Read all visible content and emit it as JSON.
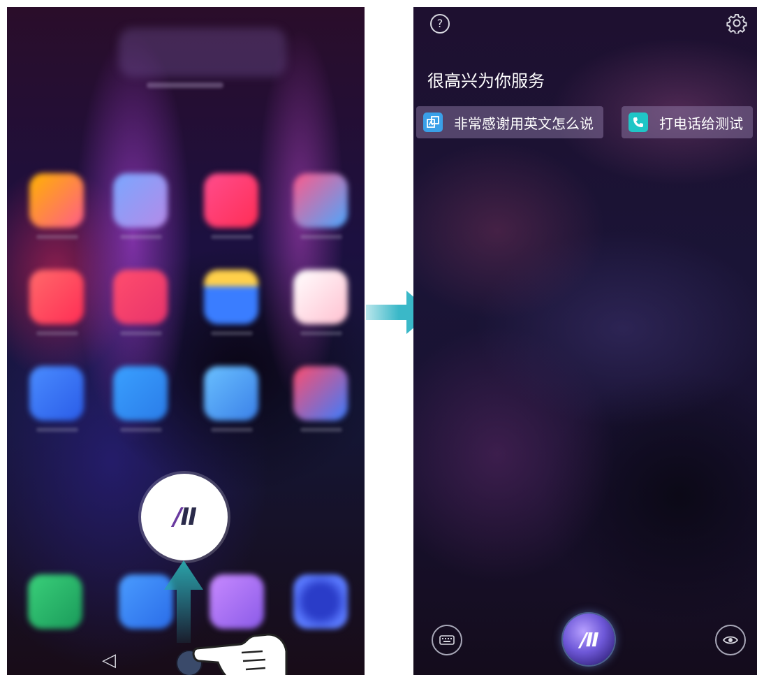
{
  "left_screen": {
    "assistant_logo": {
      "part_a": "/",
      "part_i": "II"
    }
  },
  "right_screen": {
    "greeting": "很高兴为你服务",
    "suggestions": [
      {
        "icon": "translate-icon",
        "label": "非常感谢用英文怎么说"
      },
      {
        "icon": "phone-icon",
        "label": "打电话给测试"
      }
    ],
    "help_symbol": "?",
    "assistant_logo": {
      "part_a": "/",
      "part_i": "II"
    }
  },
  "colors": {
    "transition_arrow": "#3ab8c8",
    "swipe_arrow": "#2aa3a8",
    "translate_chip_icon": "#3aa0e8",
    "phone_chip_icon": "#1fc6c6"
  }
}
